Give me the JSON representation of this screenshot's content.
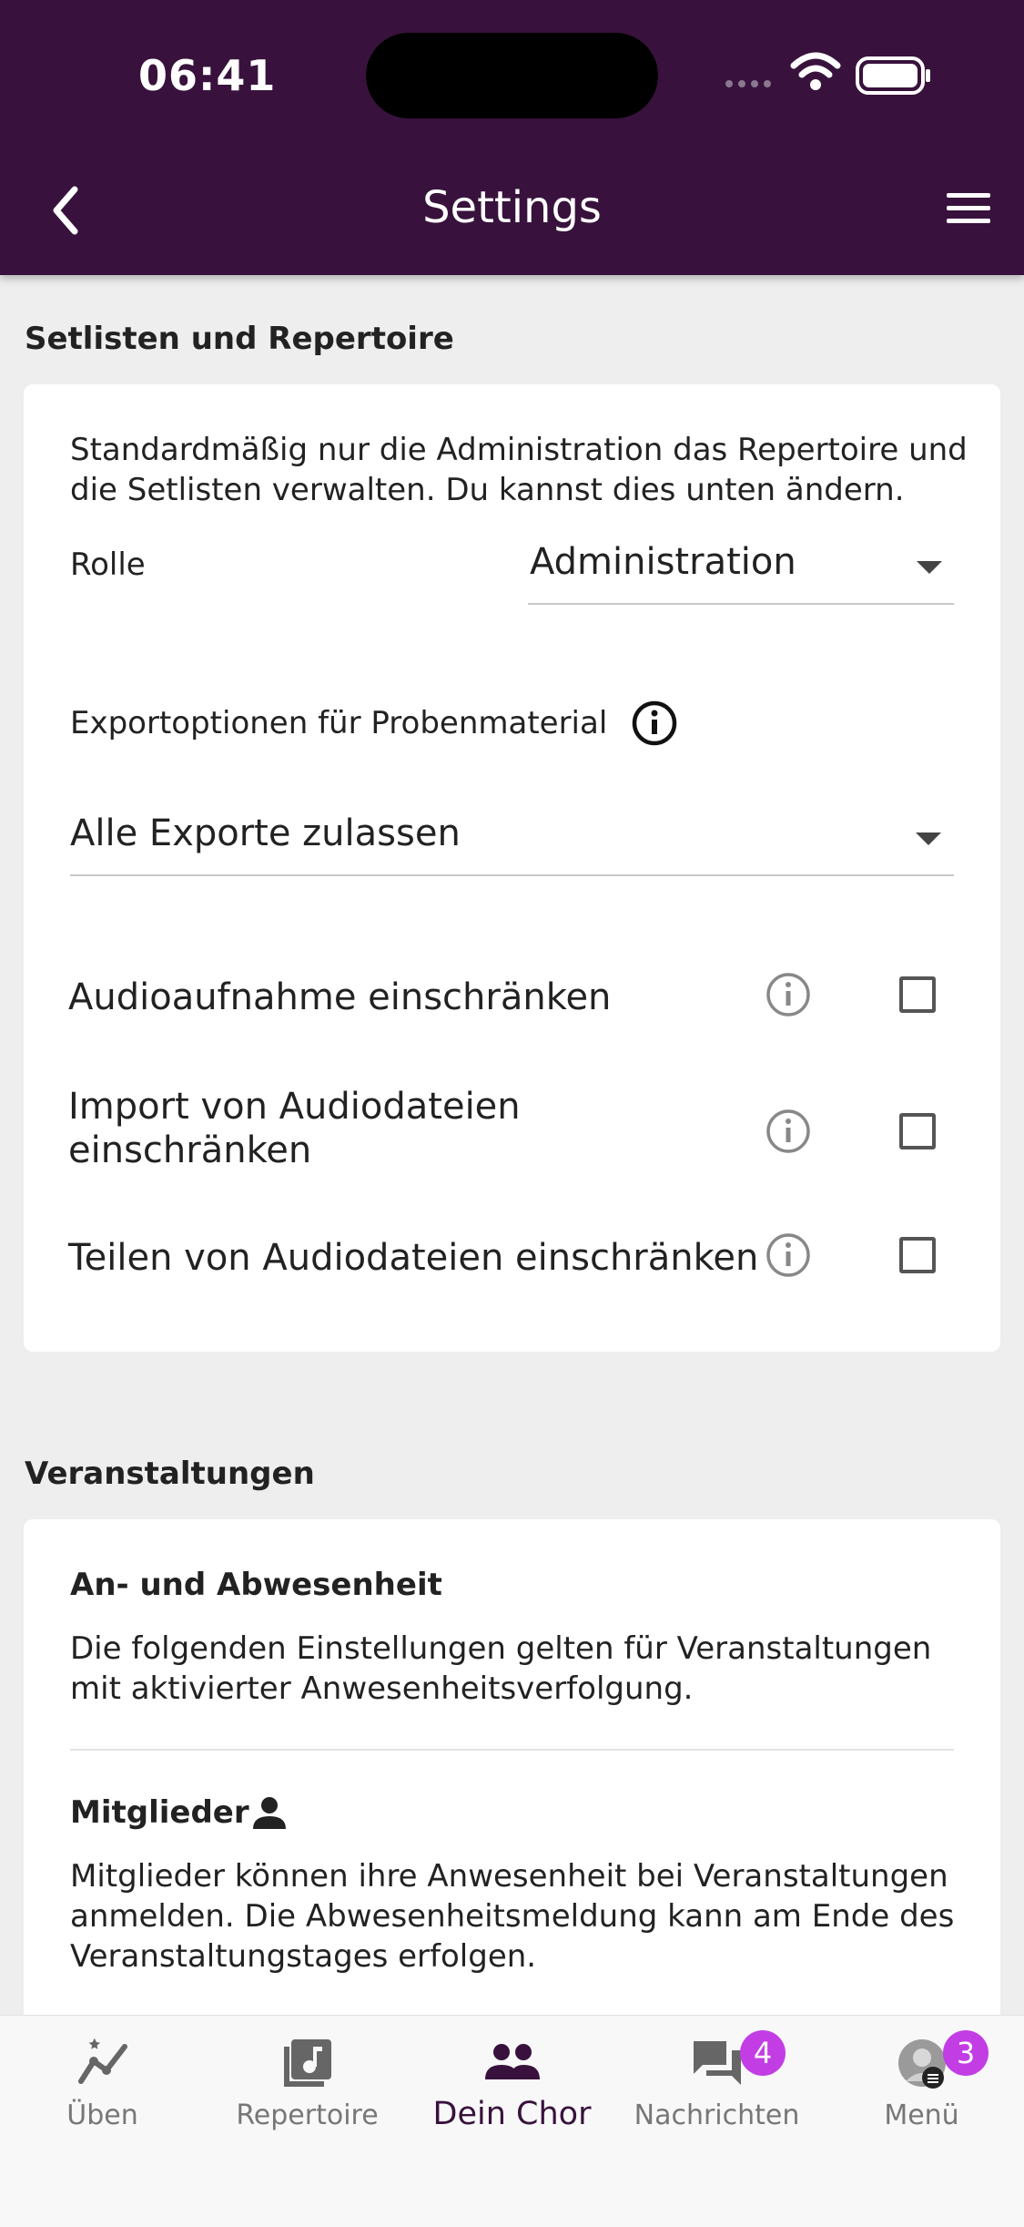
{
  "status_bar": {
    "time": "06:41"
  },
  "header": {
    "title": "Settings"
  },
  "section1": {
    "title": "Setlisten und Repertoire",
    "description_line1": "Standardmäßig nur die Administration das Repertoire und",
    "description_line2": "die Setlisten verwalten. Du kannst dies unten ändern.",
    "role_label": "Rolle",
    "role_value": "Administration",
    "export_label": "Exportoptionen für Probenmaterial",
    "export_value": "Alle Exporte zulassen",
    "options": [
      {
        "line1": "Audioaufnahme einschränken",
        "line2": "",
        "checked": false
      },
      {
        "line1": "Import von Audiodateien",
        "line2": "einschränken",
        "checked": false
      },
      {
        "line1": "Teilen von Audiodateien einschränken",
        "line2": "",
        "checked": false
      }
    ]
  },
  "section2": {
    "title": "Veranstaltungen",
    "attendance_title": "An- und Abwesenheit",
    "attendance_line1": "Die folgenden Einstellungen gelten für Veranstaltungen",
    "attendance_line2": "mit aktivierter Anwesenheitsverfolgung.",
    "members_title": "Mitglieder",
    "members_line1": "Mitglieder können ihre Anwesenheit bei Veranstaltungen",
    "members_line2": "anmelden. Die Abwesenheitsmeldung kann am Ende des",
    "members_line3": "Veranstaltungstages erfolgen."
  },
  "tabbar": {
    "tabs": [
      {
        "label": "Üben",
        "icon": "chart-line-icon"
      },
      {
        "label": "Repertoire",
        "icon": "music-note-icon"
      },
      {
        "label": "Dein Chor",
        "icon": "people-icon",
        "active": true
      },
      {
        "label": "Nachrichten",
        "icon": "chat-icon",
        "badge": "4"
      },
      {
        "label": "Menü",
        "icon": "avatar-icon",
        "badge": "3"
      }
    ]
  },
  "colors": {
    "header": "#38123c",
    "badge": "#c23ee4",
    "background": "#eeeeee"
  }
}
